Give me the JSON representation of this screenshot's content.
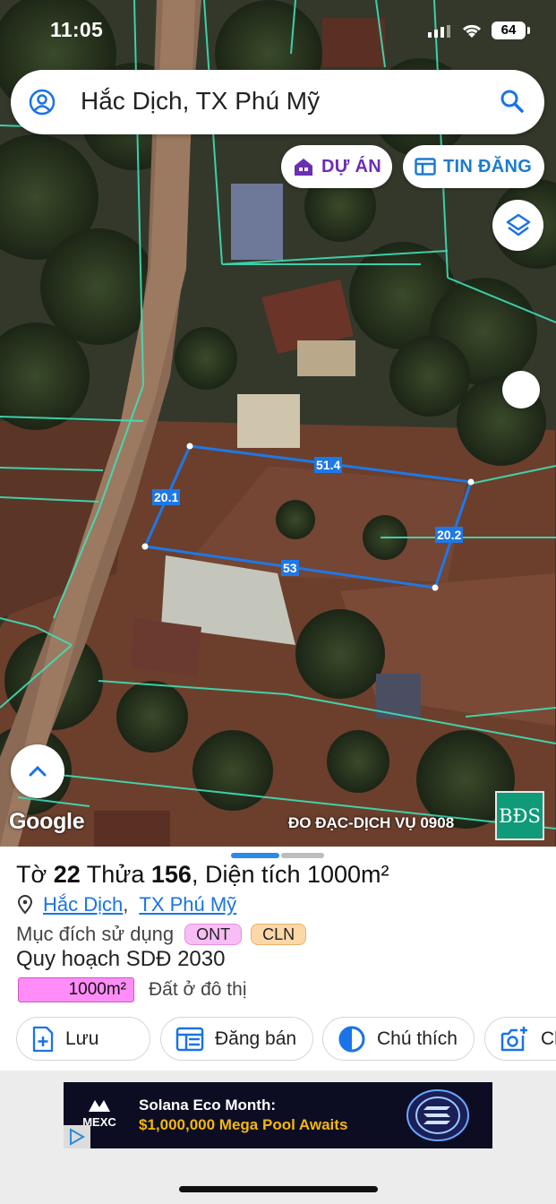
{
  "status": {
    "time": "11:05",
    "battery": "64"
  },
  "search": {
    "query": "Hắc Dịch, TX Phú Mỹ"
  },
  "chips": {
    "du_an": "DỰ ÁN",
    "tin_dang": "TIN ĐĂNG"
  },
  "map": {
    "measurements": {
      "top": "51.4",
      "left": "20.1",
      "right": "20.2",
      "bottom": "53"
    },
    "google": "Google",
    "credit": "ĐO ĐẠC-DỊCH VỤ 0908",
    "badge": "BĐS",
    "colors": {
      "parcel_line": "#1e78e6",
      "cadastral_line": "#3fe0b8"
    }
  },
  "sheet": {
    "title_prefix": "Tờ ",
    "to_number": "22",
    "title_mid": " Thửa ",
    "thua_number": "156",
    "title_suffix": ", Diện tích 1000m²",
    "ward": "Hắc Dịch",
    "separator": ",",
    "town": "TX Phú Mỹ",
    "purpose_label": "Mục đích sử dụng",
    "tags": [
      "ONT",
      "CLN"
    ],
    "plan_label": "Quy hoạch SDĐ 2030",
    "plan_area": "1000m²",
    "plan_type": "Đất ở đô thị"
  },
  "actions": {
    "save": "Lưu",
    "post": "Đăng bán",
    "legend": "Chú thích",
    "photo": "Ch"
  },
  "ad": {
    "brand": "MEXC",
    "line1": "Solana Eco Month:",
    "line2": "$1,000,000 Mega Pool Awaits"
  }
}
